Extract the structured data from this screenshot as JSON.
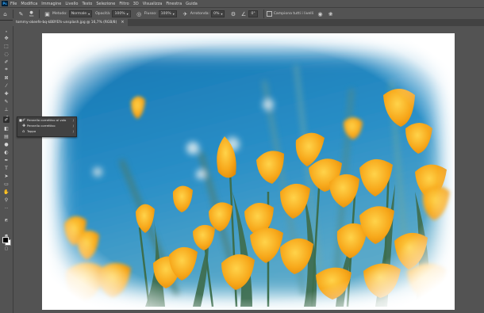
{
  "app": {
    "logo": "Ps"
  },
  "menu": [
    "File",
    "Modifica",
    "Immagine",
    "Livello",
    "Testo",
    "Selezione",
    "Filtro",
    "3D",
    "Visualizza",
    "Finestra",
    "Guida"
  ],
  "options_bar": {
    "brush_size": "300",
    "mode_label": "Metodo:",
    "mode_value": "Normale",
    "opacity_label": "Opacità:",
    "opacity_value": "100%",
    "flow_label": "Flusso:",
    "flow_value": "100%",
    "smoothing_label": "Arrotonda:",
    "smoothing_value": "0%",
    "angle_value": "0°",
    "sample_all_label": "Campiona tutti i livelli"
  },
  "document_tab": {
    "title": "tommy-okeefe-bq-kBBYEfs-unsplash.jpg @ 16,7% (RGB/8)",
    "close": "×"
  },
  "tool_flyout": {
    "items": [
      {
        "label": "Pennello correttivo al volo",
        "shortcut": "J",
        "selected": true
      },
      {
        "label": "Pennello correttivo",
        "shortcut": "J",
        "selected": false
      },
      {
        "label": "Toppa",
        "shortcut": "J",
        "selected": false
      }
    ]
  },
  "colors": {
    "fg": "#000000",
    "bg": "#ffffff",
    "ui_bg": "#535353"
  }
}
